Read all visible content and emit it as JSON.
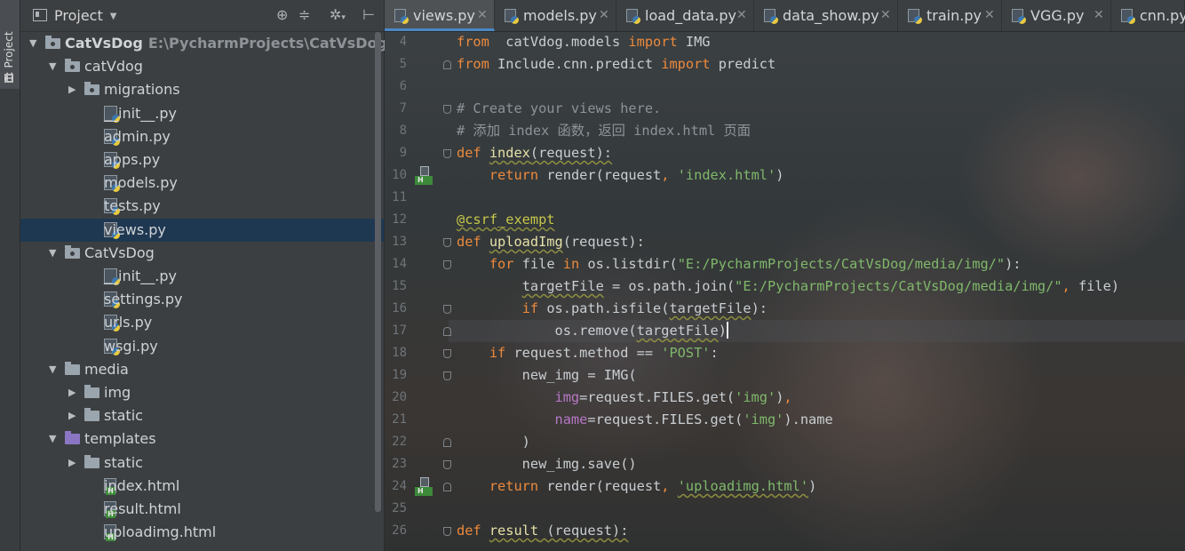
{
  "toolstrip": {
    "tab_label": "1: Project"
  },
  "project_panel": {
    "title": "Project",
    "tree": [
      {
        "label": "CatVsDog",
        "path": "E:\\PycharmProjects\\CatVsDog",
        "kind": "root",
        "depth": 0,
        "expanded": true
      },
      {
        "label": "catVdog",
        "kind": "package",
        "depth": 1,
        "expanded": true
      },
      {
        "label": "migrations",
        "kind": "package",
        "depth": 2,
        "expanded": false
      },
      {
        "label": "__init__.py",
        "kind": "py",
        "depth": 2
      },
      {
        "label": "admin.py",
        "kind": "py",
        "depth": 2
      },
      {
        "label": "apps.py",
        "kind": "py",
        "depth": 2
      },
      {
        "label": "models.py",
        "kind": "py",
        "depth": 2
      },
      {
        "label": "tests.py",
        "kind": "py",
        "depth": 2
      },
      {
        "label": "views.py",
        "kind": "py",
        "depth": 2,
        "selected": true
      },
      {
        "label": "CatVsDog",
        "kind": "package",
        "depth": 1,
        "expanded": true
      },
      {
        "label": "__init__.py",
        "kind": "py",
        "depth": 2
      },
      {
        "label": "settings.py",
        "kind": "py",
        "depth": 2
      },
      {
        "label": "urls.py",
        "kind": "py",
        "depth": 2
      },
      {
        "label": "wsgi.py",
        "kind": "py",
        "depth": 2
      },
      {
        "label": "media",
        "kind": "folder",
        "depth": 1,
        "expanded": true
      },
      {
        "label": "img",
        "kind": "folder",
        "depth": 2,
        "expanded": false
      },
      {
        "label": "static",
        "kind": "folder",
        "depth": 2,
        "expanded": false
      },
      {
        "label": "templates",
        "kind": "template-folder",
        "depth": 1,
        "expanded": true
      },
      {
        "label": "static",
        "kind": "folder",
        "depth": 2,
        "expanded": false
      },
      {
        "label": "index.html",
        "kind": "html",
        "depth": 2
      },
      {
        "label": "result.html",
        "kind": "html",
        "depth": 2
      },
      {
        "label": "uploadimg.html",
        "kind": "html",
        "depth": 2
      }
    ]
  },
  "editor": {
    "tabs": [
      {
        "label": "views.py",
        "active": true
      },
      {
        "label": "models.py"
      },
      {
        "label": "load_data.py"
      },
      {
        "label": "data_show.py"
      },
      {
        "label": "train.py"
      },
      {
        "label": "VGG.py"
      },
      {
        "label": "cnn.py"
      }
    ],
    "current_line": 17,
    "lines": [
      {
        "n": 4,
        "tokens": [
          [
            "kw",
            "from"
          ],
          [
            "",
            "  catVdog.models "
          ],
          [
            "kw",
            "import"
          ],
          [
            "",
            " IMG"
          ]
        ]
      },
      {
        "n": 5,
        "tokens": [
          [
            "kw",
            "from"
          ],
          [
            "",
            " Include.cnn.predict "
          ],
          [
            "kw",
            "import"
          ],
          [
            "",
            " predict"
          ]
        ]
      },
      {
        "n": 6,
        "tokens": []
      },
      {
        "n": 7,
        "tokens": [
          [
            "cm",
            "# Create your views here."
          ]
        ]
      },
      {
        "n": 8,
        "tokens": [
          [
            "cm",
            "# 添加 index 函数，返回 index.html 页面"
          ]
        ]
      },
      {
        "n": 9,
        "tokens": [
          [
            "kw",
            "def "
          ],
          [
            "fn ul",
            "index"
          ],
          [
            "ul",
            "(request):"
          ]
        ]
      },
      {
        "n": 10,
        "tokens": [
          [
            "",
            "    "
          ],
          [
            "kw",
            "return"
          ],
          [
            "",
            " render(request"
          ],
          [
            "kw",
            ","
          ],
          [
            "",
            " "
          ],
          [
            "str",
            "'index.html'"
          ],
          [
            "",
            ")"
          ]
        ]
      },
      {
        "n": 11,
        "tokens": []
      },
      {
        "n": 12,
        "tokens": [
          [
            "dec ul",
            "@csrf_exempt"
          ]
        ]
      },
      {
        "n": 13,
        "tokens": [
          [
            "kw",
            "def "
          ],
          [
            "fn ul",
            "uploadImg"
          ],
          [
            "",
            "(request):"
          ]
        ]
      },
      {
        "n": 14,
        "tokens": [
          [
            "",
            "    "
          ],
          [
            "kw",
            "for"
          ],
          [
            "",
            " file "
          ],
          [
            "kw",
            "in"
          ],
          [
            "",
            " os.listdir("
          ],
          [
            "str",
            "\"E:/PycharmProjects/CatVsDog/media/img/\""
          ],
          [
            "",
            "):"
          ]
        ]
      },
      {
        "n": 15,
        "tokens": [
          [
            "",
            "        "
          ],
          [
            "ul",
            "targetFile"
          ],
          [
            "",
            " = os.path.join("
          ],
          [
            "str",
            "\"E:/PycharmProjects/CatVsDog/media/img/\""
          ],
          [
            "kw",
            ","
          ],
          [
            "",
            " file)"
          ]
        ]
      },
      {
        "n": 16,
        "tokens": [
          [
            "",
            "        "
          ],
          [
            "kw",
            "if"
          ],
          [
            "",
            " os.path.isfile("
          ],
          [
            "ul",
            "targetFile"
          ],
          [
            "",
            "):"
          ]
        ]
      },
      {
        "n": 17,
        "tokens": [
          [
            "",
            "            os.remove("
          ],
          [
            "ul",
            "targetFile"
          ],
          [
            "",
            ")"
          ]
        ],
        "caret": true
      },
      {
        "n": 18,
        "tokens": [
          [
            "",
            "    "
          ],
          [
            "kw",
            "if"
          ],
          [
            "",
            " request.method == "
          ],
          [
            "str",
            "'POST'"
          ],
          [
            "",
            ":"
          ]
        ]
      },
      {
        "n": 19,
        "tokens": [
          [
            "",
            "        new_img = IMG("
          ]
        ]
      },
      {
        "n": 20,
        "tokens": [
          [
            "",
            "            "
          ],
          [
            "par",
            "img"
          ],
          [
            "",
            "=request.FILES.get("
          ],
          [
            "str",
            "'img'"
          ],
          [
            "",
            ")"
          ],
          [
            "kw",
            ","
          ]
        ]
      },
      {
        "n": 21,
        "tokens": [
          [
            "",
            "            "
          ],
          [
            "par",
            "name"
          ],
          [
            "",
            "=request.FILES.get("
          ],
          [
            "str",
            "'img'"
          ],
          [
            "",
            ").name"
          ]
        ]
      },
      {
        "n": 22,
        "tokens": [
          [
            "",
            "        )"
          ]
        ]
      },
      {
        "n": 23,
        "tokens": [
          [
            "",
            "        new_img.save()"
          ]
        ]
      },
      {
        "n": 24,
        "tokens": [
          [
            "",
            "    "
          ],
          [
            "kw",
            "return"
          ],
          [
            "",
            " render(request"
          ],
          [
            "kw",
            ","
          ],
          [
            "",
            " "
          ],
          [
            "str ul",
            "'uploadimg.html'"
          ],
          [
            "",
            ")"
          ]
        ]
      },
      {
        "n": 25,
        "tokens": []
      },
      {
        "n": 26,
        "tokens": [
          [
            "kw",
            "def "
          ],
          [
            "fn ul",
            "result"
          ],
          [
            "ul",
            " (request):"
          ]
        ]
      }
    ]
  }
}
